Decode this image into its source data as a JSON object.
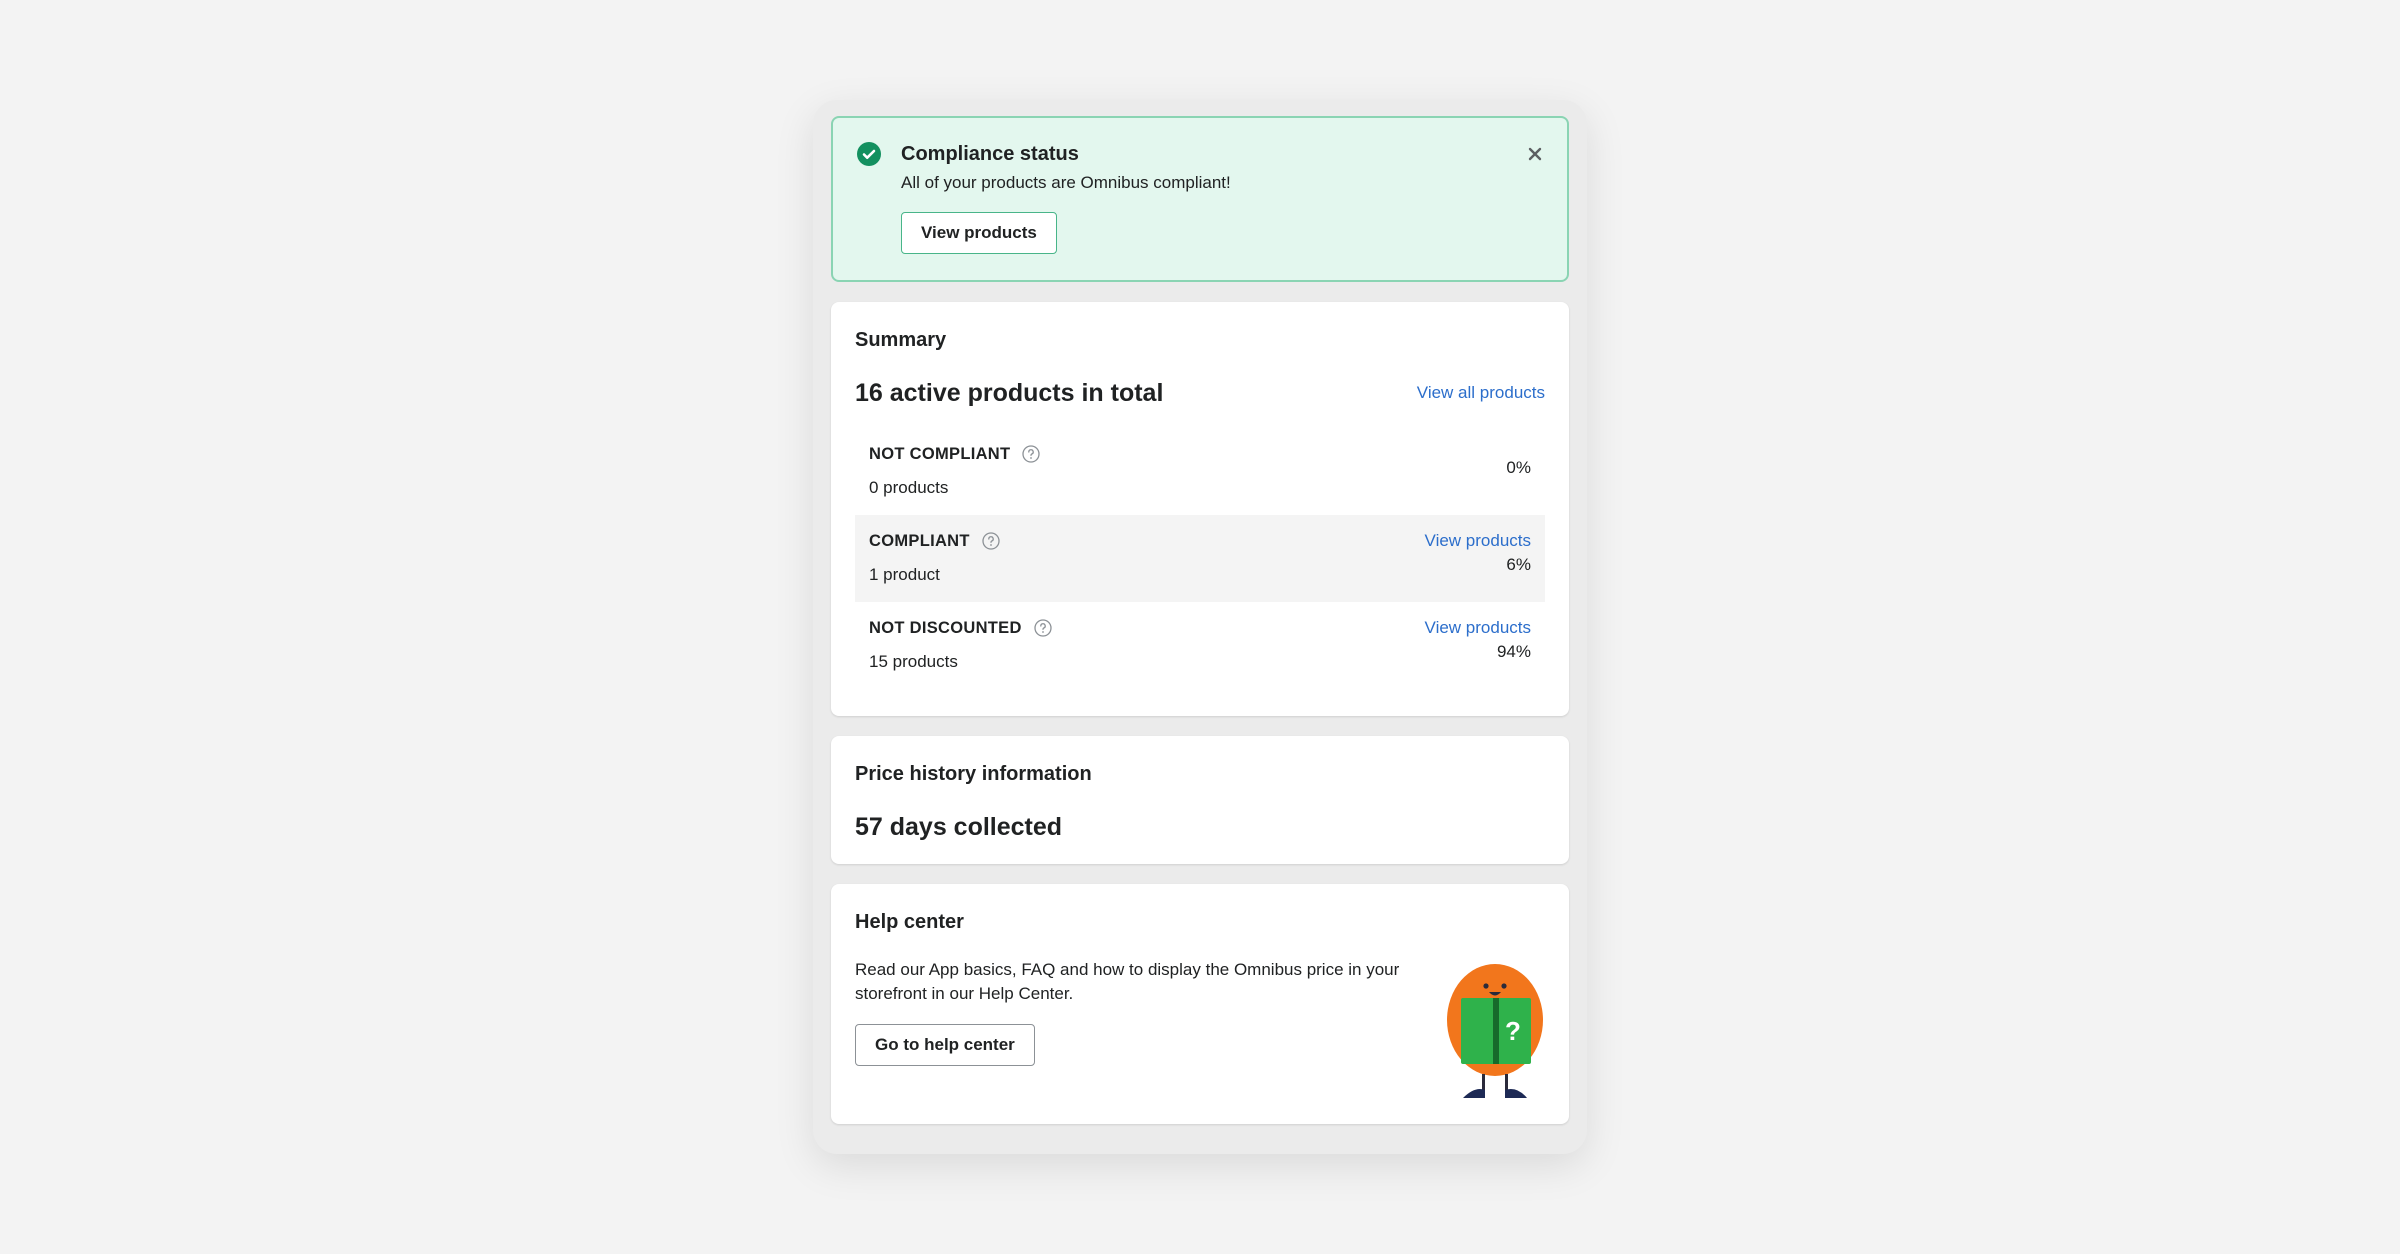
{
  "banner": {
    "title": "Compliance status",
    "text": "All of your products are Omnibus compliant!",
    "button_label": "View products",
    "icons": {
      "status": "check-circle-icon",
      "close": "close-icon"
    },
    "colors": {
      "background": "#e3f7ee",
      "border": "#8ad4b3",
      "check": "#13905f"
    }
  },
  "summary": {
    "title": "Summary",
    "headline": "16 active products in total",
    "view_all_label": "View all products",
    "rows": [
      {
        "label": "NOT COMPLIANT",
        "count": "0 products",
        "link": "",
        "percent": "0%"
      },
      {
        "label": "COMPLIANT",
        "count": "1 product",
        "link": "View products",
        "percent": "6%"
      },
      {
        "label": "NOT DISCOUNTED",
        "count": "15 products",
        "link": "View products",
        "percent": "94%"
      }
    ]
  },
  "price_history": {
    "title": "Price history information",
    "headline": "57 days collected"
  },
  "help_center": {
    "title": "Help center",
    "text": "Read our App basics, FAQ and how to display the Omnibus price in your storefront in our Help Center.",
    "button_label": "Go to help center",
    "mascot_glyph": "?"
  },
  "colors": {
    "link": "#2c6ecb",
    "page": "#f3f3f3",
    "frame": "#ebebeb"
  }
}
